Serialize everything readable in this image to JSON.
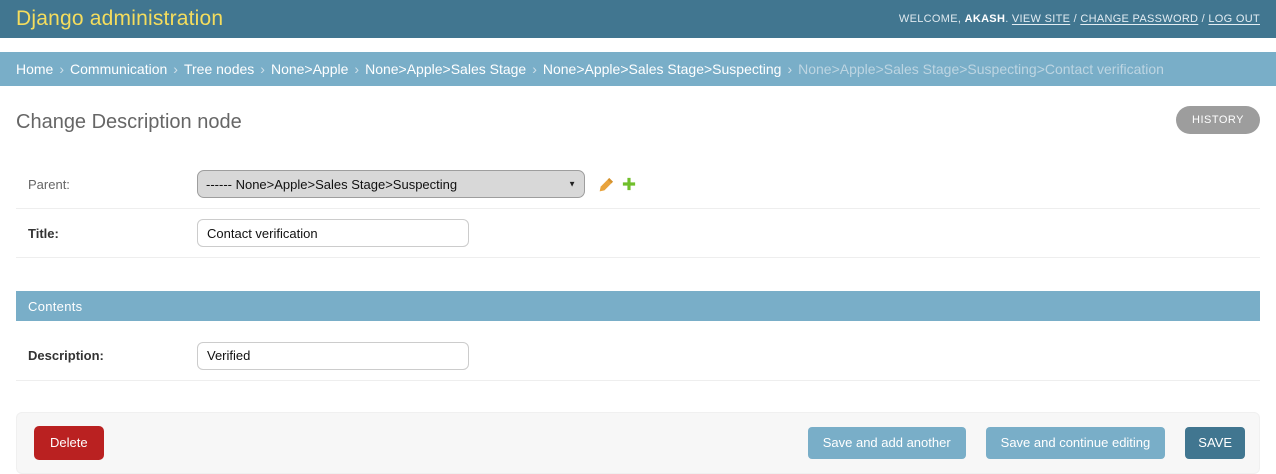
{
  "header": {
    "branding": "Django administration",
    "user_tools": {
      "welcome_prefix": "WELCOME, ",
      "username": "AKASH",
      "after_username": ". ",
      "view_site": "VIEW SITE",
      "change_password": "CHANGE PASSWORD",
      "log_out": "LOG OUT",
      "link_separator": " / "
    }
  },
  "breadcrumbs": {
    "separator": "›",
    "links": [
      "Home",
      "Communication",
      "Tree nodes",
      "None>Apple",
      "None>Apple>Sales Stage",
      "None>Apple>Sales Stage>Suspecting"
    ],
    "current": "None>Apple>Sales Stage>Suspecting>Contact verification"
  },
  "page": {
    "title": "Change Description node",
    "history_button": "HISTORY"
  },
  "form": {
    "parent": {
      "label": "Parent:",
      "selected_option": "------ None>Apple>Sales Stage>Suspecting",
      "edit_icon": "pencil-icon",
      "add_icon": "plus-icon"
    },
    "title": {
      "label": "Title:",
      "value": "Contact verification"
    },
    "contents_section_caption": "Contents",
    "description": {
      "label": "Description:",
      "value": "Verified"
    }
  },
  "submit_row": {
    "delete_label": "Delete",
    "save_add_label": "Save and add another",
    "save_continue_label": "Save and continue editing",
    "save_label": "SAVE"
  },
  "colors": {
    "header_bg": "#417690",
    "branding_text": "#f5dd5d",
    "breadcrumb_bg": "#79aec8",
    "module_caption_bg": "#79aec8",
    "button_blue": "#79aec8",
    "button_default": "#417690",
    "delete_red": "#ba2121",
    "history_gray": "#9d9d9d",
    "edit_icon_gold": "#e8a33d",
    "add_icon_green": "#70bf2b"
  }
}
